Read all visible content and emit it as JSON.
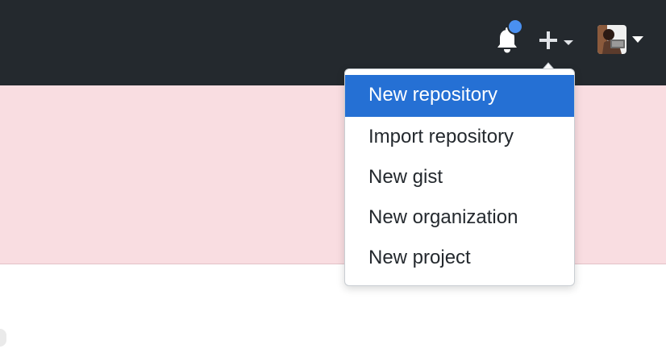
{
  "header": {
    "icons": {
      "notifications": "bell-icon",
      "create": "plus-icon",
      "create_menu_caret": "caret-down-icon",
      "profile_caret": "caret-down-icon"
    },
    "colors": {
      "header_bg": "#24292e",
      "notification_dot": "#4a90f0"
    }
  },
  "flash_banner": {
    "color": "#f9dde1"
  },
  "create_menu": {
    "items": [
      {
        "label": "New repository",
        "active": true
      },
      {
        "label": "Import repository",
        "active": false
      },
      {
        "label": "New gist",
        "active": false
      },
      {
        "label": "New organization",
        "active": false
      },
      {
        "label": "New project",
        "active": false
      }
    ],
    "active_color": "#2570d4"
  }
}
